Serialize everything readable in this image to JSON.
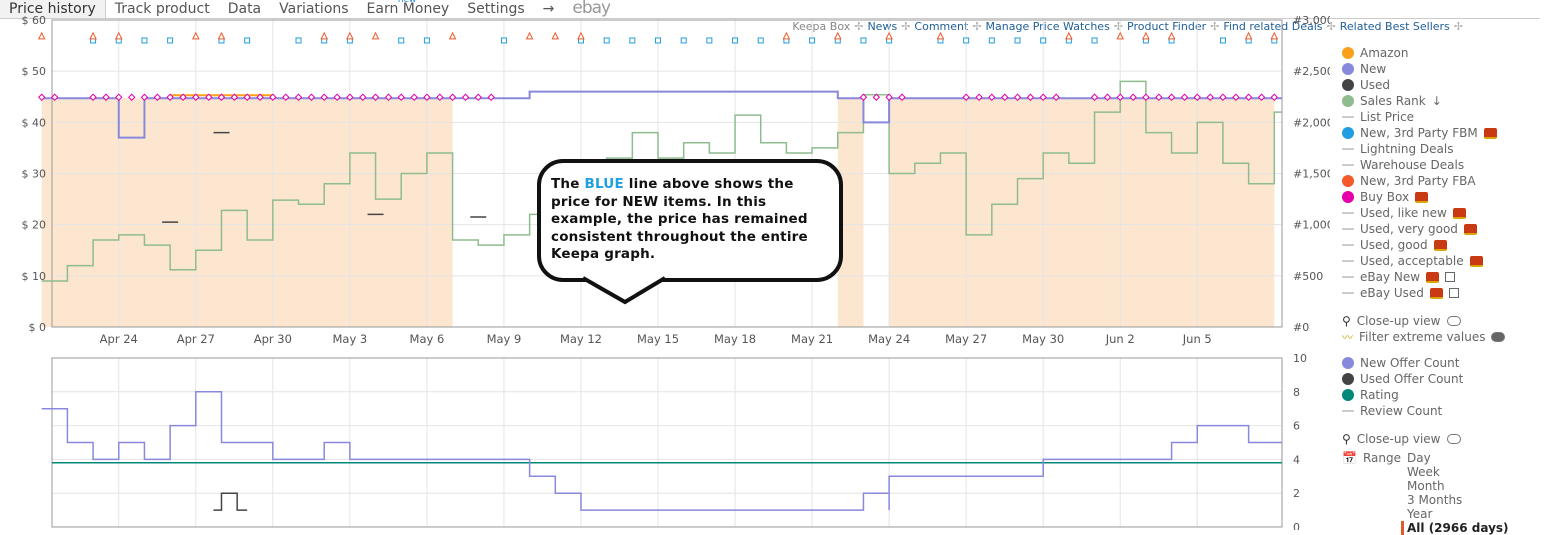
{
  "tabs": [
    {
      "label": "Price history",
      "active": true
    },
    {
      "label": "Track product"
    },
    {
      "label": "Data"
    },
    {
      "label": "Variations"
    },
    {
      "label": "Earn Money",
      "badge": "new"
    },
    {
      "label": "Settings"
    }
  ],
  "tabs_arrow": "→",
  "tabs_ebay": "ebay",
  "toplinks": {
    "keepa_box": "Keepa Box",
    "items": [
      "News",
      "Comment",
      "Manage Price Watches",
      "Product Finder",
      "Find related Deals",
      "Related Best Sellers"
    ],
    "sep": "✢"
  },
  "colors": {
    "amazon": "#f9a11b",
    "new": "#8888dd",
    "used": "#444444",
    "sales_rank": "#8fbc8f",
    "fbm": "#1e9de0",
    "fba": "#f4592b",
    "buy_box": "#e600ac",
    "rating": "#00897b",
    "shade": "#fde6d0",
    "grid": "#e4e4e4"
  },
  "legend_main": [
    {
      "label": "Amazon",
      "marker": "dot",
      "color": "#f9a11b"
    },
    {
      "label": "New",
      "marker": "dot",
      "color": "#8888dd"
    },
    {
      "label": "Used",
      "marker": "dot",
      "color": "#444444"
    },
    {
      "label": "Sales Rank",
      "marker": "dot",
      "color": "#8fbc8f",
      "icon": "sort-icon"
    },
    {
      "label": "List Price",
      "marker": "dash"
    },
    {
      "label": "New, 3rd Party FBM",
      "marker": "dot",
      "color": "#1e9de0",
      "truck": true
    },
    {
      "label": "Lightning Deals",
      "marker": "dash"
    },
    {
      "label": "Warehouse Deals",
      "marker": "dash"
    },
    {
      "label": "New, 3rd Party FBA",
      "marker": "dot",
      "color": "#f4592b"
    },
    {
      "label": "Buy Box",
      "marker": "dot",
      "color": "#e600ac",
      "truck": true
    },
    {
      "label": "Used, like new",
      "marker": "dash",
      "truck": true
    },
    {
      "label": "Used, very good",
      "marker": "dash",
      "truck": true
    },
    {
      "label": "Used, good",
      "marker": "dash",
      "truck": true
    },
    {
      "label": "Used, acceptable",
      "marker": "dash",
      "truck": true
    },
    {
      "label": "eBay New",
      "marker": "dash",
      "truck": true,
      "external": true
    },
    {
      "label": "eBay Used",
      "marker": "dash",
      "truck": true,
      "external": true
    }
  ],
  "main_controls": {
    "closeup": "Close-up view",
    "closeup_on": false,
    "filter": "Filter extreme values",
    "filter_on": true
  },
  "legend_bottom": [
    {
      "label": "New Offer Count",
      "marker": "dot",
      "color": "#8888dd"
    },
    {
      "label": "Used Offer Count",
      "marker": "dot",
      "color": "#444444"
    },
    {
      "label": "Rating",
      "marker": "dot",
      "color": "#00897b"
    },
    {
      "label": "Review Count",
      "marker": "dash"
    }
  ],
  "bottom_controls": {
    "closeup": "Close-up view",
    "closeup_on": false,
    "range_label": "Range",
    "range_options": [
      "Day",
      "Week",
      "Month",
      "3 Months",
      "Year",
      "All (2966 days)"
    ],
    "range_selected": "All (2966 days)"
  },
  "callout": {
    "pre": "The ",
    "highlight": "BLUE",
    "post": " line above shows the price for NEW items. In this example, the price has remained consistent throughout the entire Keepa graph."
  },
  "chart_data": [
    {
      "type": "line",
      "x_range": [
        "Apr 21",
        "Jun 8"
      ],
      "x_ticks": [
        "Apr 24",
        "Apr 27",
        "Apr 30",
        "May 3",
        "May 6",
        "May 9",
        "May 12",
        "May 15",
        "May 18",
        "May 21",
        "May 24",
        "May 27",
        "May 30",
        "Jun 2",
        "Jun 5"
      ],
      "y_left": {
        "range": [
          0,
          60
        ],
        "ticks": [
          "$ 0",
          "$ 10",
          "$ 20",
          "$ 30",
          "$ 40",
          "$ 50",
          "$ 60"
        ]
      },
      "y_right": {
        "range": [
          0,
          3000
        ],
        "ticks": [
          "#0",
          "#500",
          "#1,000",
          "#1,500",
          "#2,000",
          "#2,500",
          "#3,000"
        ]
      },
      "grid": true,
      "shaded_ranges": [
        [
          "Apr 21",
          "May 7"
        ],
        [
          "May 22",
          "May 23"
        ],
        [
          "May 24",
          "Jun 8"
        ]
      ],
      "new_price": [
        [
          "Apr 21",
          44.7
        ],
        [
          "Apr 24",
          37
        ],
        [
          "Apr 25",
          44.7
        ],
        [
          "May 10",
          46
        ],
        [
          "May 22",
          44.7
        ],
        [
          "May 23",
          40
        ],
        [
          "May 24",
          44.7
        ],
        [
          "Jun 8",
          44.7
        ]
      ],
      "amazon_price": [
        [
          "Apr 26",
          45.3
        ],
        [
          "Apr 30",
          45.3
        ]
      ],
      "buy_box": {
        "value": 44.9,
        "dates": [
          "Apr 21",
          "Apr 23",
          "Apr 24",
          "Apr 25",
          "Apr 26",
          "Apr 27",
          "Apr 28",
          "Apr 29",
          "Apr 30",
          "May 1",
          "May 2",
          "May 3",
          "May 4",
          "May 5",
          "May 6",
          "May 7",
          "May 8",
          "May 23",
          "May 24",
          "May 27",
          "May 28",
          "May 29",
          "May 30",
          "Jun 1",
          "Jun 2",
          "Jun 3",
          "Jun 4",
          "Jun 5",
          "Jun 6",
          "Jun 7",
          "Jun 8"
        ]
      },
      "fbm": {
        "value": 56,
        "dates": [
          "Apr 23",
          "Apr 24",
          "Apr 25",
          "Apr 26",
          "Apr 28",
          "Apr 29",
          "May 1",
          "May 2",
          "May 3",
          "May 5",
          "May 6",
          "May 9",
          "May 12",
          "May 13",
          "May 14",
          "May 15",
          "May 16",
          "May 17",
          "May 18",
          "May 19",
          "May 20",
          "May 21",
          "May 22",
          "May 23",
          "May 24",
          "May 26",
          "May 27",
          "May 28",
          "May 29",
          "May 30",
          "May 31",
          "Jun 1",
          "Jun 3",
          "Jun 4",
          "Jun 6",
          "Jun 7",
          "Jun 8"
        ]
      },
      "fba": {
        "value": 56.5,
        "dates": [
          "Apr 21",
          "Apr 23",
          "Apr 24",
          "Apr 27",
          "Apr 28",
          "May 2",
          "May 3",
          "May 4",
          "May 7",
          "May 10",
          "May 11",
          "May 12",
          "May 20",
          "May 22",
          "May 24",
          "May 26",
          "May 31",
          "Jun 2",
          "Jun 3",
          "Jun 4",
          "Jun 7",
          "Jun 8"
        ]
      },
      "used_price": [
        [
          "Apr 26",
          20.5
        ],
        [
          "Apr 28",
          38
        ],
        [
          "May 4",
          22
        ],
        [
          "May 8",
          21.5
        ]
      ],
      "sales_rank": [
        [
          "Apr 21",
          450
        ],
        [
          "Apr 22",
          600
        ],
        [
          "Apr 23",
          850
        ],
        [
          "Apr 24",
          900
        ],
        [
          "Apr 25",
          800
        ],
        [
          "Apr 26",
          560
        ],
        [
          "Apr 27",
          750
        ],
        [
          "Apr 28",
          1140
        ],
        [
          "Apr 29",
          850
        ],
        [
          "Apr 30",
          1240
        ],
        [
          "May 1",
          1200
        ],
        [
          "May 2",
          1400
        ],
        [
          "May 3",
          1700
        ],
        [
          "May 4",
          1250
        ],
        [
          "May 5",
          1500
        ],
        [
          "May 6",
          1700
        ],
        [
          "May 7",
          850
        ],
        [
          "May 8",
          800
        ],
        [
          "May 9",
          900
        ],
        [
          "May 10",
          1100
        ],
        [
          "May 11",
          1300
        ],
        [
          "May 12",
          1500
        ],
        [
          "May 13",
          1650
        ],
        [
          "May 14",
          1900
        ],
        [
          "May 15",
          1650
        ],
        [
          "May 16",
          1800
        ],
        [
          "May 17",
          1700
        ],
        [
          "May 18",
          2070
        ],
        [
          "May 19",
          1800
        ],
        [
          "May 20",
          1700
        ],
        [
          "May 21",
          1750
        ],
        [
          "May 22",
          1900
        ],
        [
          "May 23",
          2270
        ],
        [
          "May 24",
          1500
        ],
        [
          "May 25",
          1600
        ],
        [
          "May 26",
          1700
        ],
        [
          "May 27",
          900
        ],
        [
          "May 28",
          1200
        ],
        [
          "May 29",
          1450
        ],
        [
          "May 30",
          1700
        ],
        [
          "May 31",
          1600
        ],
        [
          "Jun 1",
          2100
        ],
        [
          "Jun 2",
          2400
        ],
        [
          "Jun 3",
          1900
        ],
        [
          "Jun 4",
          1700
        ],
        [
          "Jun 5",
          2000
        ],
        [
          "Jun 6",
          1600
        ],
        [
          "Jun 7",
          1400
        ],
        [
          "Jun 8",
          2100
        ]
      ]
    },
    {
      "type": "line",
      "x_range": [
        "Apr 21",
        "Jun 8"
      ],
      "y": {
        "range": [
          0,
          10
        ],
        "ticks": [
          "0",
          "2",
          "4",
          "6",
          "8",
          "10"
        ]
      },
      "grid": true,
      "rating": 3.8,
      "new_offer_count": [
        [
          "Apr 21",
          7
        ],
        [
          "Apr 22",
          5
        ],
        [
          "Apr 23",
          4
        ],
        [
          "Apr 24",
          5
        ],
        [
          "Apr 25",
          4
        ],
        [
          "Apr 26",
          5
        ],
        [
          "Apr 26",
          6
        ],
        [
          "Apr 27",
          7
        ],
        [
          "Apr 27",
          8
        ],
        [
          "Apr 28",
          7
        ],
        [
          "Apr 28",
          5
        ],
        [
          "Apr 30",
          4
        ],
        [
          "May 2",
          5
        ],
        [
          "May 3",
          4
        ],
        [
          "May 10",
          3
        ],
        [
          "May 11",
          2
        ],
        [
          "May 12",
          1
        ],
        [
          "May 23",
          2
        ],
        [
          "May 24",
          1
        ],
        [
          "May 24",
          3
        ],
        [
          "May 29",
          3
        ],
        [
          "May 30",
          4
        ],
        [
          "Jun 1",
          4
        ],
        [
          "Jun 4",
          5
        ],
        [
          "Jun 5",
          6
        ],
        [
          "Jun 7",
          5
        ],
        [
          "Jun 8",
          5
        ]
      ],
      "used_offer_count": [
        [
          "Apr 28",
          2
        ],
        [
          "Apr 29",
          0
        ]
      ]
    }
  ]
}
